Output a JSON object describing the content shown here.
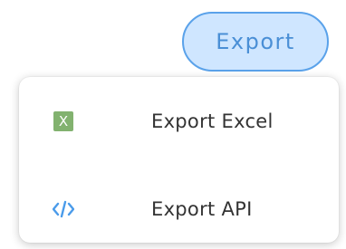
{
  "export_button": {
    "label": "Export"
  },
  "menu": {
    "items": [
      {
        "label": "Export Excel",
        "icon": "excel-icon",
        "icon_text": "X"
      },
      {
        "label": "Export API",
        "icon": "code-icon"
      }
    ]
  },
  "colors": {
    "button_bg": "#cfe6ff",
    "button_border": "#5aa2ea",
    "button_text": "#4a8fd6",
    "excel_icon": "#82b26f",
    "code_icon": "#4a9bea",
    "menu_text": "#333333"
  }
}
